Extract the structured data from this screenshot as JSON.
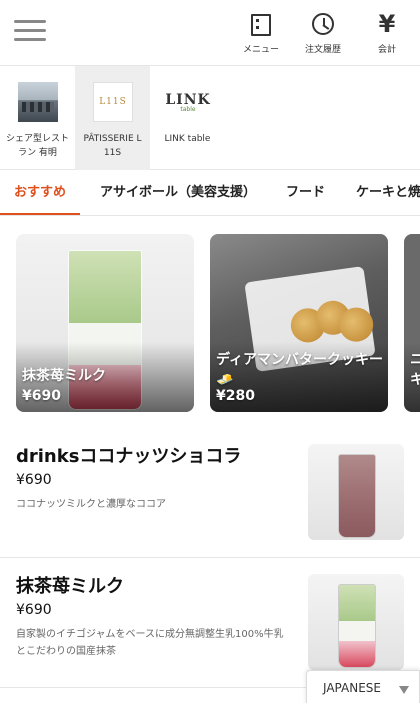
{
  "header": {
    "nav": [
      {
        "label": "メニュー",
        "icon": "menu-icon"
      },
      {
        "label": "注文履歴",
        "icon": "history-icon"
      },
      {
        "label": "会計",
        "icon": "yen-icon",
        "glyph": "¥"
      }
    ]
  },
  "shops": [
    {
      "name": "シェア型レストラン 有明",
      "selected": false
    },
    {
      "name": "PÂTISSERIE L 11S",
      "logo_text": "L11S",
      "selected": true
    },
    {
      "name": "LINK table",
      "logo_text": "LINK",
      "logo_sub": "table",
      "selected": false
    }
  ],
  "tabs": [
    {
      "label": "おすすめ",
      "active": true
    },
    {
      "label": "アサイボール（美容支援）",
      "active": false
    },
    {
      "label": "フード",
      "active": false
    },
    {
      "label": "ケーキと焼",
      "active": false
    }
  ],
  "featured": [
    {
      "name": "抹茶苺ミルク",
      "price": "¥690"
    },
    {
      "name": "ディアマンバタークッキー🧈",
      "price": "¥280"
    },
    {
      "name": "ニキ",
      "price": ""
    }
  ],
  "items": [
    {
      "name": "drinksココナッツショコラ",
      "price": "¥690",
      "description": "ココナッツミルクと濃厚なココア"
    },
    {
      "name": "抹茶苺ミルク",
      "price": "¥690",
      "description": "自家製のイチゴジャムをベースに成分無調整生乳100%牛乳とこだわりの国産抹茶"
    }
  ],
  "language": {
    "label": "JAPANESE"
  },
  "colors": {
    "accent": "#e0501e",
    "selected_shop_bg": "#eeeeee"
  }
}
